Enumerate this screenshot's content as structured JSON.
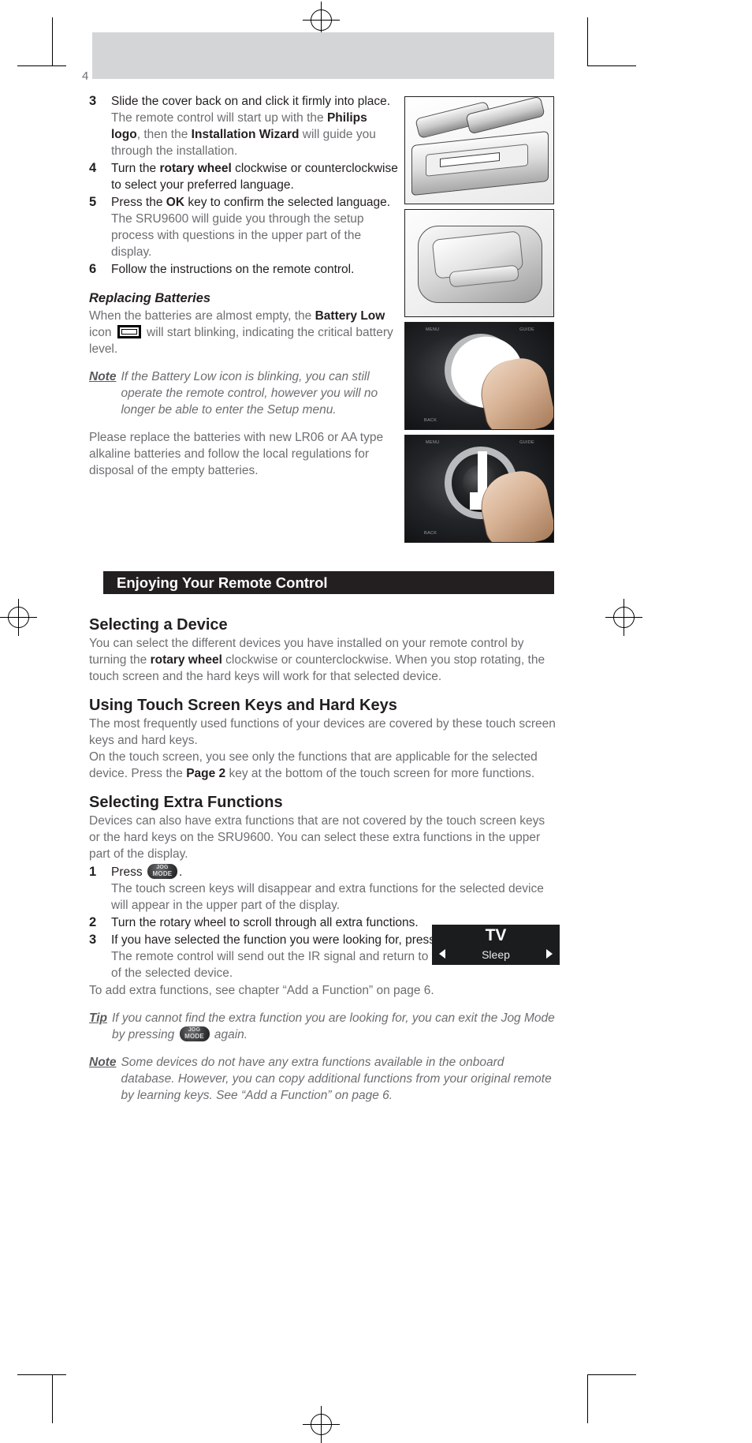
{
  "page": {
    "folio": "4"
  },
  "steps_top": [
    {
      "num": "3",
      "lead_plain": "Slide the cover back on and click it firmly into place.",
      "sub_pre": "The remote control will start up with the ",
      "sub_b1": "Philips logo",
      "sub_mid": ", then the ",
      "sub_b2": "Installation Wizard",
      "sub_post": " will guide you through the installation."
    },
    {
      "num": "4",
      "lead_pre": "Turn the ",
      "lead_b": "rotary wheel",
      "lead_post": " clockwise or counterclockwise to select your preferred language."
    },
    {
      "num": "5",
      "lead_pre": "Press the ",
      "lead_b": "OK",
      "lead_post": " key to confirm the selected language.",
      "sub": "The SRU9600 will guide you through the setup process with questions in the upper part of the display."
    },
    {
      "num": "6",
      "lead_plain": "Follow the instructions on the remote control."
    }
  ],
  "replacing": {
    "heading": "Replacing Batteries",
    "p1_pre": "When the batteries are almost empty, the ",
    "p1_b": "Battery Low",
    "p1_mid": " icon ",
    "p1_post": " will start blinking, indicating the critical battery level.",
    "note_label": "Note",
    "note_text": "If the Battery Low icon is blinking, you can still operate the remote control, however you will no longer be able to enter the Setup menu.",
    "p2": "Please replace the batteries with new LR06 or AA type alkaline batteries and follow the local regulations for disposal of the empty batteries."
  },
  "section": {
    "bar_title": "Enjoying Your Remote Control"
  },
  "selecting_device": {
    "heading": "Selecting a Device",
    "p_pre": "You can select the different devices you have installed on your remote control by turning the ",
    "p_b": "rotary wheel",
    "p_post": " clockwise or counterclockwise. When you stop rotating, the touch screen and the hard keys will work for that selected device."
  },
  "touch_keys": {
    "heading": "Using Touch Screen Keys and Hard Keys",
    "p1": "The most frequently used functions of your devices are covered by these touch screen keys and hard keys.",
    "p2_pre": "On the touch screen, you see only the functions that are applicable for the selected device. Press the ",
    "p2_b": "Page 2",
    "p2_post": " key at the bottom of the touch screen for more functions."
  },
  "extra_functions": {
    "heading": "Selecting Extra Functions",
    "intro": "Devices can also have extra functions that are not covered by the touch screen keys or the hard keys on the SRU9600. You can select these extra functions in the upper part of the display.",
    "steps": [
      {
        "num": "1",
        "lead_pre": "Press",
        "lead_post": ".",
        "sub": "The touch screen keys will disappear and extra functions for the selected device will appear in the upper part of the display."
      },
      {
        "num": "2",
        "lead_plain": "Turn the rotary wheel to scroll through all extra functions."
      },
      {
        "num": "3",
        "lead_pre": "If you have selected the function you were looking for, press",
        "lead_post": ".",
        "sub": "The remote control will send out the IR signal and return to the touch screen keys of the selected device."
      }
    ],
    "closing": "To add extra functions, see chapter “Add a Function” on page 6.",
    "tip_label": "Tip",
    "tip_pre": "If you cannot find the extra function you are looking for, you can exit the Jog Mode by pressing",
    "tip_post": "again.",
    "note_label": "Note",
    "note_text": "Some devices do not have any extra functions available in the onboard database. However, you can copy additional functions from your original remote by learning keys. See “Add a Function” on page 6."
  },
  "icons": {
    "battery_low": "battery-low-icon",
    "jog_mode_line1": "JOG",
    "jog_mode_line2": "MODE",
    "ok_label": "OK"
  },
  "lcd_display": {
    "device": "TV",
    "function": "Sleep",
    "arrow_left": "◀",
    "arrow_right": "▶"
  },
  "colors": {
    "bar_background": "#231f20",
    "banner_grey": "#d4d5d7",
    "body_text": "#6d6e71",
    "emphasis_text": "#231f20"
  }
}
